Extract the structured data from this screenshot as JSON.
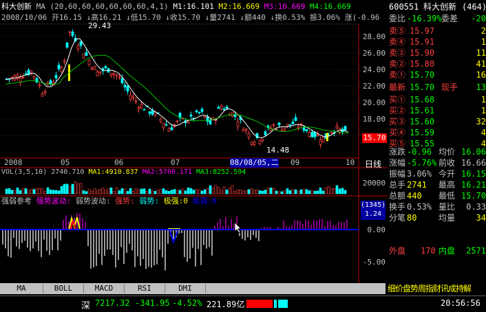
{
  "stock": {
    "code": "600551",
    "name": "科大创新",
    "name_label": "科大创新",
    "market_code": "(464)",
    "ma_line": "MA (20,60,60,60,60,60,60,4,1)",
    "ma_values": [
      {
        "label": "M1:16.101",
        "color": "#ffffff"
      },
      {
        "label": "M2:16.669",
        "color": "#ffff00"
      },
      {
        "label": "M3:16.669",
        "color": "#ff00ff"
      },
      {
        "label": "M4:16.669",
        "color": "#00ff00"
      }
    ],
    "ohlc_line": "2008/10/06 开16.15 ↓高16.21 ↓低15.70 ↓收15.70 ↓量2741 ↓额440 ↓换0.53% 振3.06% 涨(-0.96"
  },
  "price_axis": {
    "ticks": [
      "28.00",
      "26.00",
      "24.00",
      "22.00",
      "20.00",
      "18.00",
      "16.00"
    ],
    "current_price": "15.70",
    "max_marker": "29.43",
    "min_marker": "14.48",
    "time_labels": [
      "2008",
      "05",
      "06",
      "07",
      "08/08/05,二",
      "09",
      "10"
    ],
    "period_label": "日线"
  },
  "volume": {
    "header": "VOL(3,5,10) 2740.710",
    "ma1": "MA1:4910.837",
    "ma2": "MA2:5700.171",
    "ma3": "MA3:8252.594",
    "tick": "20000"
  },
  "indicator": {
    "header_parts": [
      {
        "text": "强弱参考",
        "color": "#c0c0c0"
      },
      {
        "text": "强势波动:",
        "color": "#ff00ff"
      },
      {
        "text": "弱势波动:",
        "color": "#c0c0c0"
      },
      {
        "text": "强势:",
        "color": "#ff4040"
      },
      {
        "text": "弱势:",
        "color": "#00ffff"
      },
      {
        "text": "极强:0",
        "color": "#ffff00"
      },
      {
        "text": "极弱:0",
        "color": "#0000ff"
      }
    ],
    "box_top": "(1345)",
    "box_bottom": "1.24",
    "ticks": [
      "5.00",
      "0.00",
      "-5.00"
    ]
  },
  "tabs": [
    "MA",
    "BOLL",
    "MACD",
    "RSI",
    "DMI"
  ],
  "right_panel": {
    "ratio_label": "委比",
    "ratio_value": "-16.39%",
    "diff_label": "委差",
    "diff_value": "-20",
    "sells": [
      {
        "label": "卖⑤",
        "price": "15.97",
        "vol": "2"
      },
      {
        "label": "卖④",
        "price": "15.91",
        "vol": "1"
      },
      {
        "label": "卖③",
        "price": "15.90",
        "vol": "11"
      },
      {
        "label": "卖②",
        "price": "15.80",
        "vol": "41"
      },
      {
        "label": "卖①",
        "price": "15.70",
        "vol": "16"
      }
    ],
    "latest_label": "最新",
    "latest_price": "15.70",
    "now_label": "现手",
    "now_value": "13",
    "buys": [
      {
        "label": "买①",
        "price": "15.68",
        "vol": "1"
      },
      {
        "label": "买②",
        "price": "15.61",
        "vol": "1"
      },
      {
        "label": "买③",
        "price": "15.60",
        "vol": "32"
      },
      {
        "label": "买④",
        "price": "15.59",
        "vol": "4"
      },
      {
        "label": "买⑤",
        "price": "15.55",
        "vol": "4"
      }
    ],
    "stats": [
      {
        "l1": "涨跌",
        "v1": "-0.96",
        "c1": "#00ff00",
        "l2": "均价",
        "v2": "16.06",
        "c2": "#00ff00"
      },
      {
        "l1": "涨幅",
        "v1": "-5.76%",
        "c1": "#00ff00",
        "l2": "前收",
        "v2": "16.66",
        "c2": "#c0c0c0"
      },
      {
        "l1": "振幅",
        "v1": "3.06%",
        "c1": "#c0c0c0",
        "l2": "今开",
        "v2": "16.15",
        "c2": "#00ff00"
      },
      {
        "l1": "总手",
        "v1": "2741",
        "c1": "#ffff00",
        "l2": "最高",
        "v2": "16.21",
        "c2": "#00ff00"
      },
      {
        "l1": "总额",
        "v1": "440",
        "c1": "#ffff00",
        "l2": "最低",
        "v2": "15.70",
        "c2": "#00ff00"
      },
      {
        "l1": "换手",
        "v1": "0.53%",
        "c1": "#c0c0c0",
        "l2": "量比",
        "v2": "0.33",
        "c2": "#c0c0c0"
      },
      {
        "l1": "分笔",
        "v1": "80",
        "c1": "#ffff00",
        "l2": "均量",
        "v2": "34",
        "c2": "#ffff00"
      }
    ],
    "outer_label": "外盘",
    "outer_value": "170",
    "inner_label": "内盘",
    "inner_value": "2571",
    "footer_tabs": "细价盘势周指财讯成持解"
  },
  "status_bar": {
    "market": "深",
    "index": "7217.32",
    "change": "-341.95",
    "pct": "-4.52%",
    "amount": "221.89亿",
    "time": "20:56:56"
  }
}
